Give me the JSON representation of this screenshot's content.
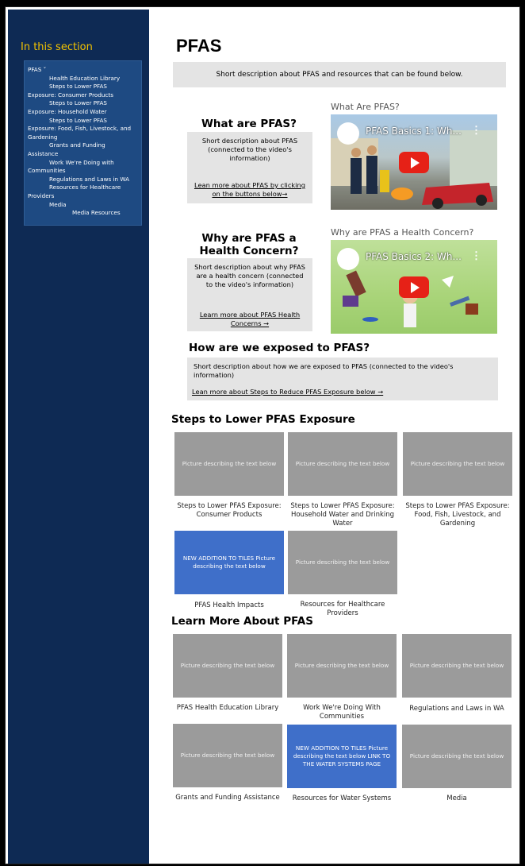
{
  "sidebar": {
    "title": "In this section",
    "items": [
      {
        "label": "PFAS ˅",
        "level": 0
      },
      {
        "label": "Health Education Library",
        "level": 1
      },
      {
        "label": "Steps to Lower PFAS",
        "level": 1
      },
      {
        "label": "Exposure: Consumer Products",
        "level": 0
      },
      {
        "label": "Steps to Lower PFAS",
        "level": 1
      },
      {
        "label": "Exposure: Household Water",
        "level": 0
      },
      {
        "label": "Steps to Lower PFAS",
        "level": 1
      },
      {
        "label": "Exposure: Food, Fish, Livestock, and",
        "level": 0
      },
      {
        "label": "Gardening",
        "level": 0
      },
      {
        "label": "Grants and Funding",
        "level": 1
      },
      {
        "label": "Assistance",
        "level": 0
      },
      {
        "label": "Work We're Doing with",
        "level": 1
      },
      {
        "label": "Communities",
        "level": 0
      },
      {
        "label": "Regulations and Laws in WA",
        "level": 1
      },
      {
        "label": "Resources for Healthcare",
        "level": 1
      },
      {
        "label": "Providers",
        "level": 0
      },
      {
        "label": "Media",
        "level": 1
      },
      {
        "label": "Media Resources",
        "level": 2
      }
    ]
  },
  "page_title": "PFAS",
  "intro_text": "Short description about PFAS and resources that can be found below.",
  "what": {
    "heading": "What are PFAS?",
    "desc": "Short description about PFAS (connected to the video's information)",
    "link": "Lean more about PFAS by clicking on the buttons below→",
    "video_label": "What Are PFAS?",
    "video_title": "PFAS Basics 1: Wh..."
  },
  "why": {
    "heading": "Why are PFAS a Health Concern?",
    "desc": "Short description about why PFAS are a health concern (connected to the video's information)",
    "link": "Learn more about PFAS Health Concerns →",
    "video_label": "Why are PFAS a Health Concern?",
    "video_title": "PFAS Basics 2: Wh..."
  },
  "exposed": {
    "heading": "How are we exposed to PFAS?",
    "desc": "Short description about how we are exposed to PFAS (connected to the video's information)",
    "link": "Lean more about Steps to Reduce PFAS Exposure below →"
  },
  "steps_section": {
    "heading": "Steps to Lower PFAS Exposure",
    "tiles": [
      {
        "image_text": "Picture describing the text below",
        "caption": "Steps to Lower PFAS Exposure: Consumer Products",
        "highlight": false
      },
      {
        "image_text": "Picture describing the text below",
        "caption": "Steps to Lower PFAS Exposure: Household Water and Drinking Water",
        "highlight": false
      },
      {
        "image_text": "Picture describing the text below",
        "caption": "Steps to Lower PFAS Exposure: Food, Fish, Livestock, and Gardening",
        "highlight": false
      },
      {
        "image_text": "NEW ADDITION TO TILES Picture describing the text below",
        "caption": "PFAS Health Impacts",
        "highlight": true
      },
      {
        "image_text": "Picture describing the text below",
        "caption": "Resources for Healthcare Providers",
        "highlight": false
      }
    ]
  },
  "learn_section": {
    "heading": "Learn More About PFAS",
    "tiles": [
      {
        "image_text": "Picture describing the text below",
        "caption": "PFAS Health Education Library",
        "highlight": false
      },
      {
        "image_text": "Picture describing the text below",
        "caption": "Work We're Doing With Communities",
        "highlight": false
      },
      {
        "image_text": "Picture describing the text below",
        "caption": "Regulations and Laws in WA",
        "highlight": false
      },
      {
        "image_text": "Picture describing the text below",
        "caption": "Grants and Funding Assistance",
        "highlight": false
      },
      {
        "image_text": "NEW ADDITION TO TILES Picture describing the text below LINK TO THE WATER SYSTEMS PAGE",
        "caption": "Resources for Water Systems",
        "highlight": true
      },
      {
        "image_text": "Picture describing the text below",
        "caption": "Media",
        "highlight": false
      }
    ]
  },
  "colors": {
    "sidebar_bg": "#0e2a54",
    "sidebar_box": "#1e4a82",
    "sidebar_title": "#f2c200",
    "tile_grey": "#9b9b9b",
    "tile_blue": "#3f6fc9",
    "youtube_red": "#e62117"
  }
}
